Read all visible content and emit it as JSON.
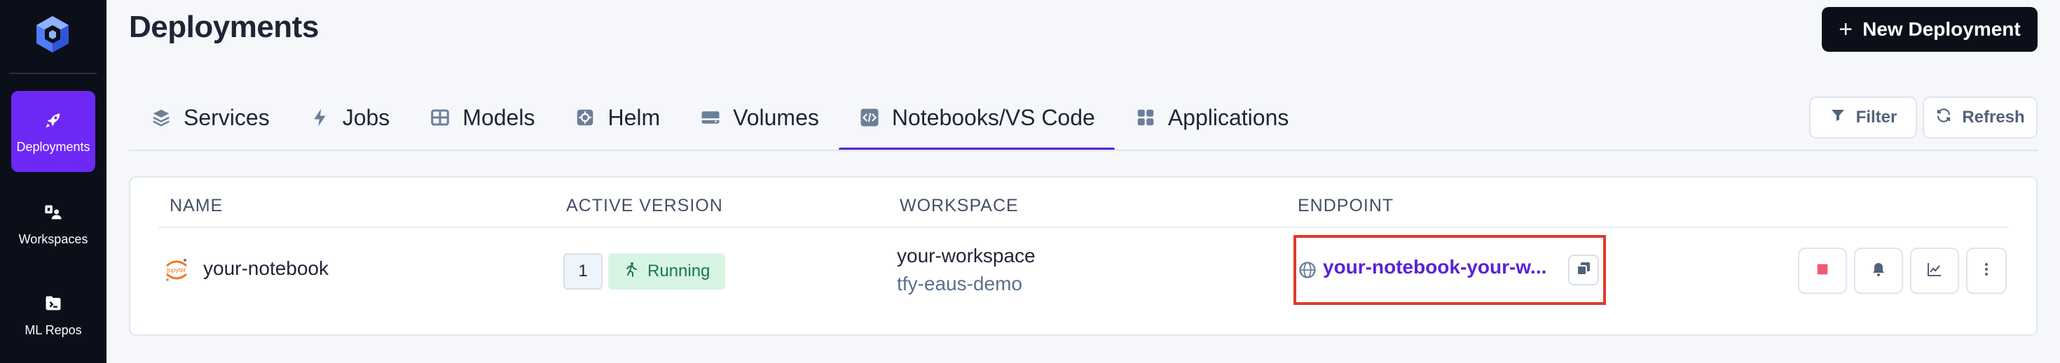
{
  "sidebar": {
    "logo": "truefoundry-logo-icon",
    "items": [
      {
        "label": "Deployments",
        "icon": "rocket-icon",
        "active": true
      },
      {
        "label": "Workspaces",
        "icon": "workspaces-icon",
        "active": false
      },
      {
        "label": "ML Repos",
        "icon": "ml-repos-icon",
        "active": false
      }
    ]
  },
  "header": {
    "title": "Deployments",
    "new_button_label": "New Deployment",
    "new_button_icon": "plus-icon"
  },
  "tabs": [
    {
      "label": "Services",
      "icon": "layers-icon",
      "active": false
    },
    {
      "label": "Jobs",
      "icon": "bolt-icon",
      "active": false
    },
    {
      "label": "Models",
      "icon": "models-icon",
      "active": false
    },
    {
      "label": "Helm",
      "icon": "helm-icon",
      "active": false
    },
    {
      "label": "Volumes",
      "icon": "volumes-icon",
      "active": false
    },
    {
      "label": "Notebooks/VS Code",
      "icon": "code-icon",
      "active": true
    },
    {
      "label": "Applications",
      "icon": "apps-icon",
      "active": false
    }
  ],
  "toolbar": {
    "filter_label": "Filter",
    "refresh_label": "Refresh"
  },
  "table": {
    "columns": [
      "NAME",
      "ACTIVE VERSION",
      "WORKSPACE",
      "ENDPOINT"
    ],
    "rows": [
      {
        "name": "your-notebook",
        "name_icon": "jupyter-icon",
        "icon_text": "jupyter",
        "version": "1",
        "status": "Running",
        "workspace": "your-workspace",
        "workspace_sub": "tfy-eaus-demo",
        "endpoint": "your-notebook-your-workspace",
        "endpoint_display": "your-notebook-your-w..."
      }
    ]
  },
  "colors": {
    "sidebar_bg": "#0b0f19",
    "accent": "#5b21d6",
    "active_nav": "#6d28f5",
    "status_running_bg": "#d8f5e4",
    "status_running_text": "#1a7a44",
    "highlight_box": "#e03a2c"
  }
}
